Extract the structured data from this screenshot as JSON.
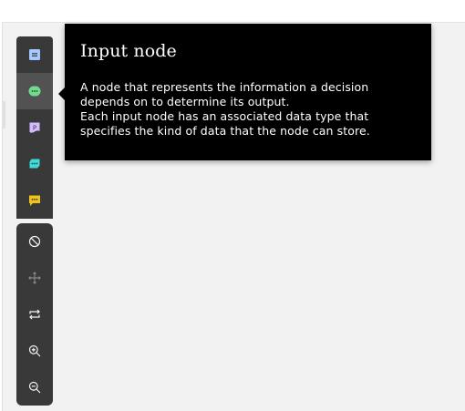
{
  "palette": {
    "items": [
      {
        "name": "decision",
        "icon": "decision-node-icon",
        "color": "#a6c8ff"
      },
      {
        "name": "input",
        "icon": "input-node-icon",
        "color": "#6fdc8c",
        "active": true
      },
      {
        "name": "knowledge-source",
        "icon": "knowledge-source-node-icon",
        "color": "#d4bbff",
        "glyph": "P"
      },
      {
        "name": "business-knowledge",
        "icon": "business-knowledge-node-icon",
        "color": "#3ddbd9"
      },
      {
        "name": "text-annotation",
        "icon": "text-annotation-node-icon",
        "color": "#f1c21b"
      }
    ]
  },
  "tools": {
    "items": [
      {
        "name": "clear",
        "icon": "prohibit-icon"
      },
      {
        "name": "pan",
        "icon": "move-icon"
      },
      {
        "name": "swap",
        "icon": "repeat-icon"
      },
      {
        "name": "zoom-in",
        "icon": "zoom-in-icon"
      },
      {
        "name": "zoom-out",
        "icon": "zoom-out-icon"
      }
    ]
  },
  "tooltip": {
    "title": "Input node",
    "body_line1": "A node that represents the information a decision depends on to determine its output.",
    "body_line2": "Each input node has an associated data type that specifies the kind of data that the node can store."
  }
}
